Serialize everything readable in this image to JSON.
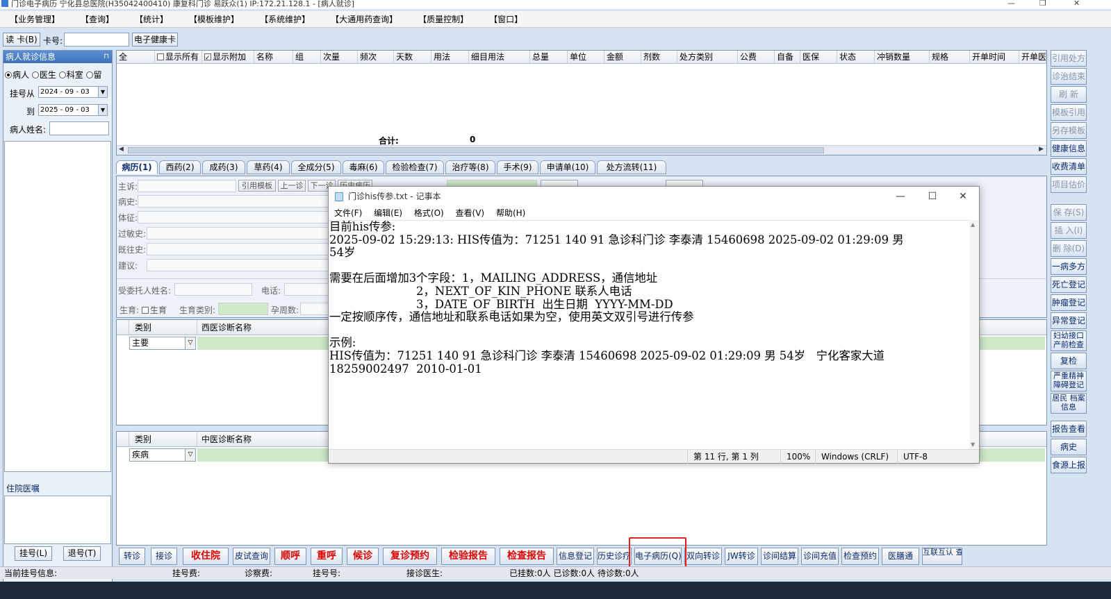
{
  "window": {
    "title": "门诊电子病历  宁化县总医院(H35042400410)  康复科门诊  易跃众(1) IP:172.21.128.1 - [病人就诊]"
  },
  "menu": [
    "【业务管理】",
    "【查询】",
    "【统计】",
    "【模板维护】",
    "【系统维护】",
    "【大通用药查询】",
    "【质量控制】",
    "【窗口】"
  ],
  "card": {
    "read_card": "读 卡(B)",
    "card_no_label": "卡号:",
    "card_no_value": "",
    "health_card": "电子健康卡"
  },
  "left": {
    "header": "病人就诊信息",
    "filters": [
      "病人",
      "医生",
      "科室",
      "留"
    ],
    "reg_from_label": "挂号从",
    "reg_from": "2024 - 09 - 03",
    "reg_to_label": "到",
    "reg_to": "2025 - 09 - 03",
    "name_label": "病人姓名:",
    "inpatient_order": "住院医嘱",
    "register_btn": "挂号(L)",
    "unregister_btn": "退号(T)"
  },
  "rx": {
    "columns": [
      "全",
      "显示所有",
      "显示附加",
      "名称",
      "组",
      "次量",
      "频次",
      "天数",
      "用法",
      "细目用法",
      "总量",
      "单位",
      "金额",
      "剂数",
      "处方类别",
      "公费",
      "自备",
      "医保",
      "状态",
      "冲销数量",
      "规格",
      "开单时间",
      "开单医生"
    ],
    "total_label": "合计:",
    "total_value": "0"
  },
  "tabs": [
    "病历(1)",
    "西药(2)",
    "成药(3)",
    "草药(4)",
    "全成分(5)",
    "毒麻(6)",
    "检验检查(7)",
    "治疗等(8)",
    "手术(9)",
    "申请单(10)",
    "处方流转(11)"
  ],
  "form": {
    "chief": "主诉:",
    "history": "病史:",
    "exam": "体征:",
    "allergy": "过敏史:",
    "past": "既往史:",
    "advice": "建议:",
    "cite_template": "引用模板",
    "prev": "上一诊",
    "next": "下一诊",
    "hist": "历史病历",
    "trustee": "受委托人姓名:",
    "phone": "电话:",
    "birth": "生育:",
    "birth_cb": "生育",
    "birth_type": "生育类别:",
    "pregnancy": "孕周数:"
  },
  "diag_west": {
    "col_type": "类别",
    "col_name": "西医诊断名称",
    "row_type": "主要"
  },
  "diag_tcm": {
    "col_type": "类别",
    "col_name": "中医诊断名称",
    "row_type": "疾病"
  },
  "right_buttons": [
    "引用处方",
    "诊治结束",
    "刷 新",
    "模板引用",
    "另存模板",
    "健康信息",
    "收费清单",
    "项目估价",
    "保 存(S)",
    "插 入(I)",
    "删 除(D)",
    "一病多方",
    "死亡登记",
    "肿瘤登记",
    "异常登记",
    "妇幼接口 产前检查",
    "复检",
    "严重精神 障碍登记",
    "居民 档案信息",
    "报告查看",
    "病史",
    "食源上报"
  ],
  "bottom_buttons": [
    "转诊",
    "接诊",
    "收住院",
    "皮试查询",
    "顺呼",
    "重呼",
    "候诊",
    "复诊预约",
    "检验报告",
    "检查报告",
    "信息登记",
    "历史诊疗",
    "电子病历(Q)",
    "双向转诊",
    "JW转诊",
    "诊间结算",
    "诊间充值",
    "检查预约",
    "医膳通",
    "互联互认 查询"
  ],
  "status": {
    "current": "当前挂号信息:",
    "reg_fee": "挂号费:",
    "consult_fee": "诊察费:",
    "reg_no": "挂号号:",
    "doctor": "接诊医生:",
    "counts": "已挂数:0人  已诊数:0人  待诊数:0人"
  },
  "notepad": {
    "title": "门诊his传参.txt - 记事本",
    "menu": [
      "文件(F)",
      "编辑(E)",
      "格式(O)",
      "查看(V)",
      "帮助(H)"
    ],
    "lines": [
      "目前his传参:",
      "2025-09-02 15:29:13: HIS传值为：71251 140 91 急诊科门诊 李泰清 15460698 2025-09-02 01:29:09 男",
      "54岁",
      "",
      "需要在后面增加3个字段：1，MAILING_ADDRESS，通信地址",
      "                        2，NEXT_OF_KIN_PHONE 联系人电话",
      "                        3，DATE_OF_BIRTH  出生日期  YYYY-MM-DD",
      "一定按顺序传，通信地址和联系电话如果为空，使用英文双引号进行传参",
      "",
      "示例:",
      "HIS传值为：71251 140 91 急诊科门诊 李泰清 15460698 2025-09-02 01:29:09 男 54岁   宁化客家大道",
      "18259002497  2010-01-01"
    ],
    "status_pos": "第 11 行, 第 1 列",
    "status_zoom": "100%",
    "status_eol": "Windows (CRLF)",
    "status_enc": "UTF-8"
  }
}
